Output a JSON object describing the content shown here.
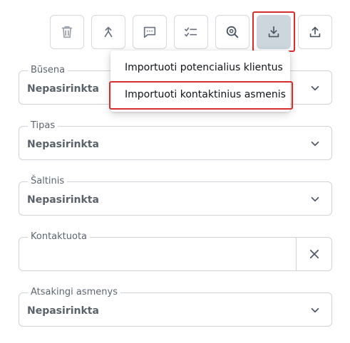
{
  "toolbar": {
    "buttons": [
      {
        "name": "delete-button",
        "icon": "trash-icon"
      },
      {
        "name": "merge-button",
        "icon": "merge-arrows-icon"
      },
      {
        "name": "comment-button",
        "icon": "comment-icon"
      },
      {
        "name": "checklist-button",
        "icon": "checklist-icon"
      },
      {
        "name": "search-button",
        "icon": "search-icon"
      },
      {
        "name": "import-button",
        "icon": "download-icon",
        "active": true
      },
      {
        "name": "export-button",
        "icon": "upload-icon"
      }
    ]
  },
  "import_menu": {
    "items": [
      {
        "label": "Importuoti potencialius klientus"
      },
      {
        "label": "Importuoti kontaktinius asmenis",
        "highlighted": true
      }
    ]
  },
  "filters": {
    "status": {
      "label": "Būsena",
      "value": "Nepasirinkta"
    },
    "type": {
      "label": "Tipas",
      "value": "Nepasirinkta"
    },
    "source": {
      "label": "Šaltinis",
      "value": "Nepasirinkta"
    },
    "contacted": {
      "label": "Kontaktuota",
      "value": ""
    },
    "responsible": {
      "label": "Atsakingi asmenys",
      "value": "Nepasirinkta"
    }
  },
  "colors": {
    "highlight": "#d32f2f",
    "active_button_bg": "#cdd5dd",
    "border": "#cfd3d8"
  }
}
